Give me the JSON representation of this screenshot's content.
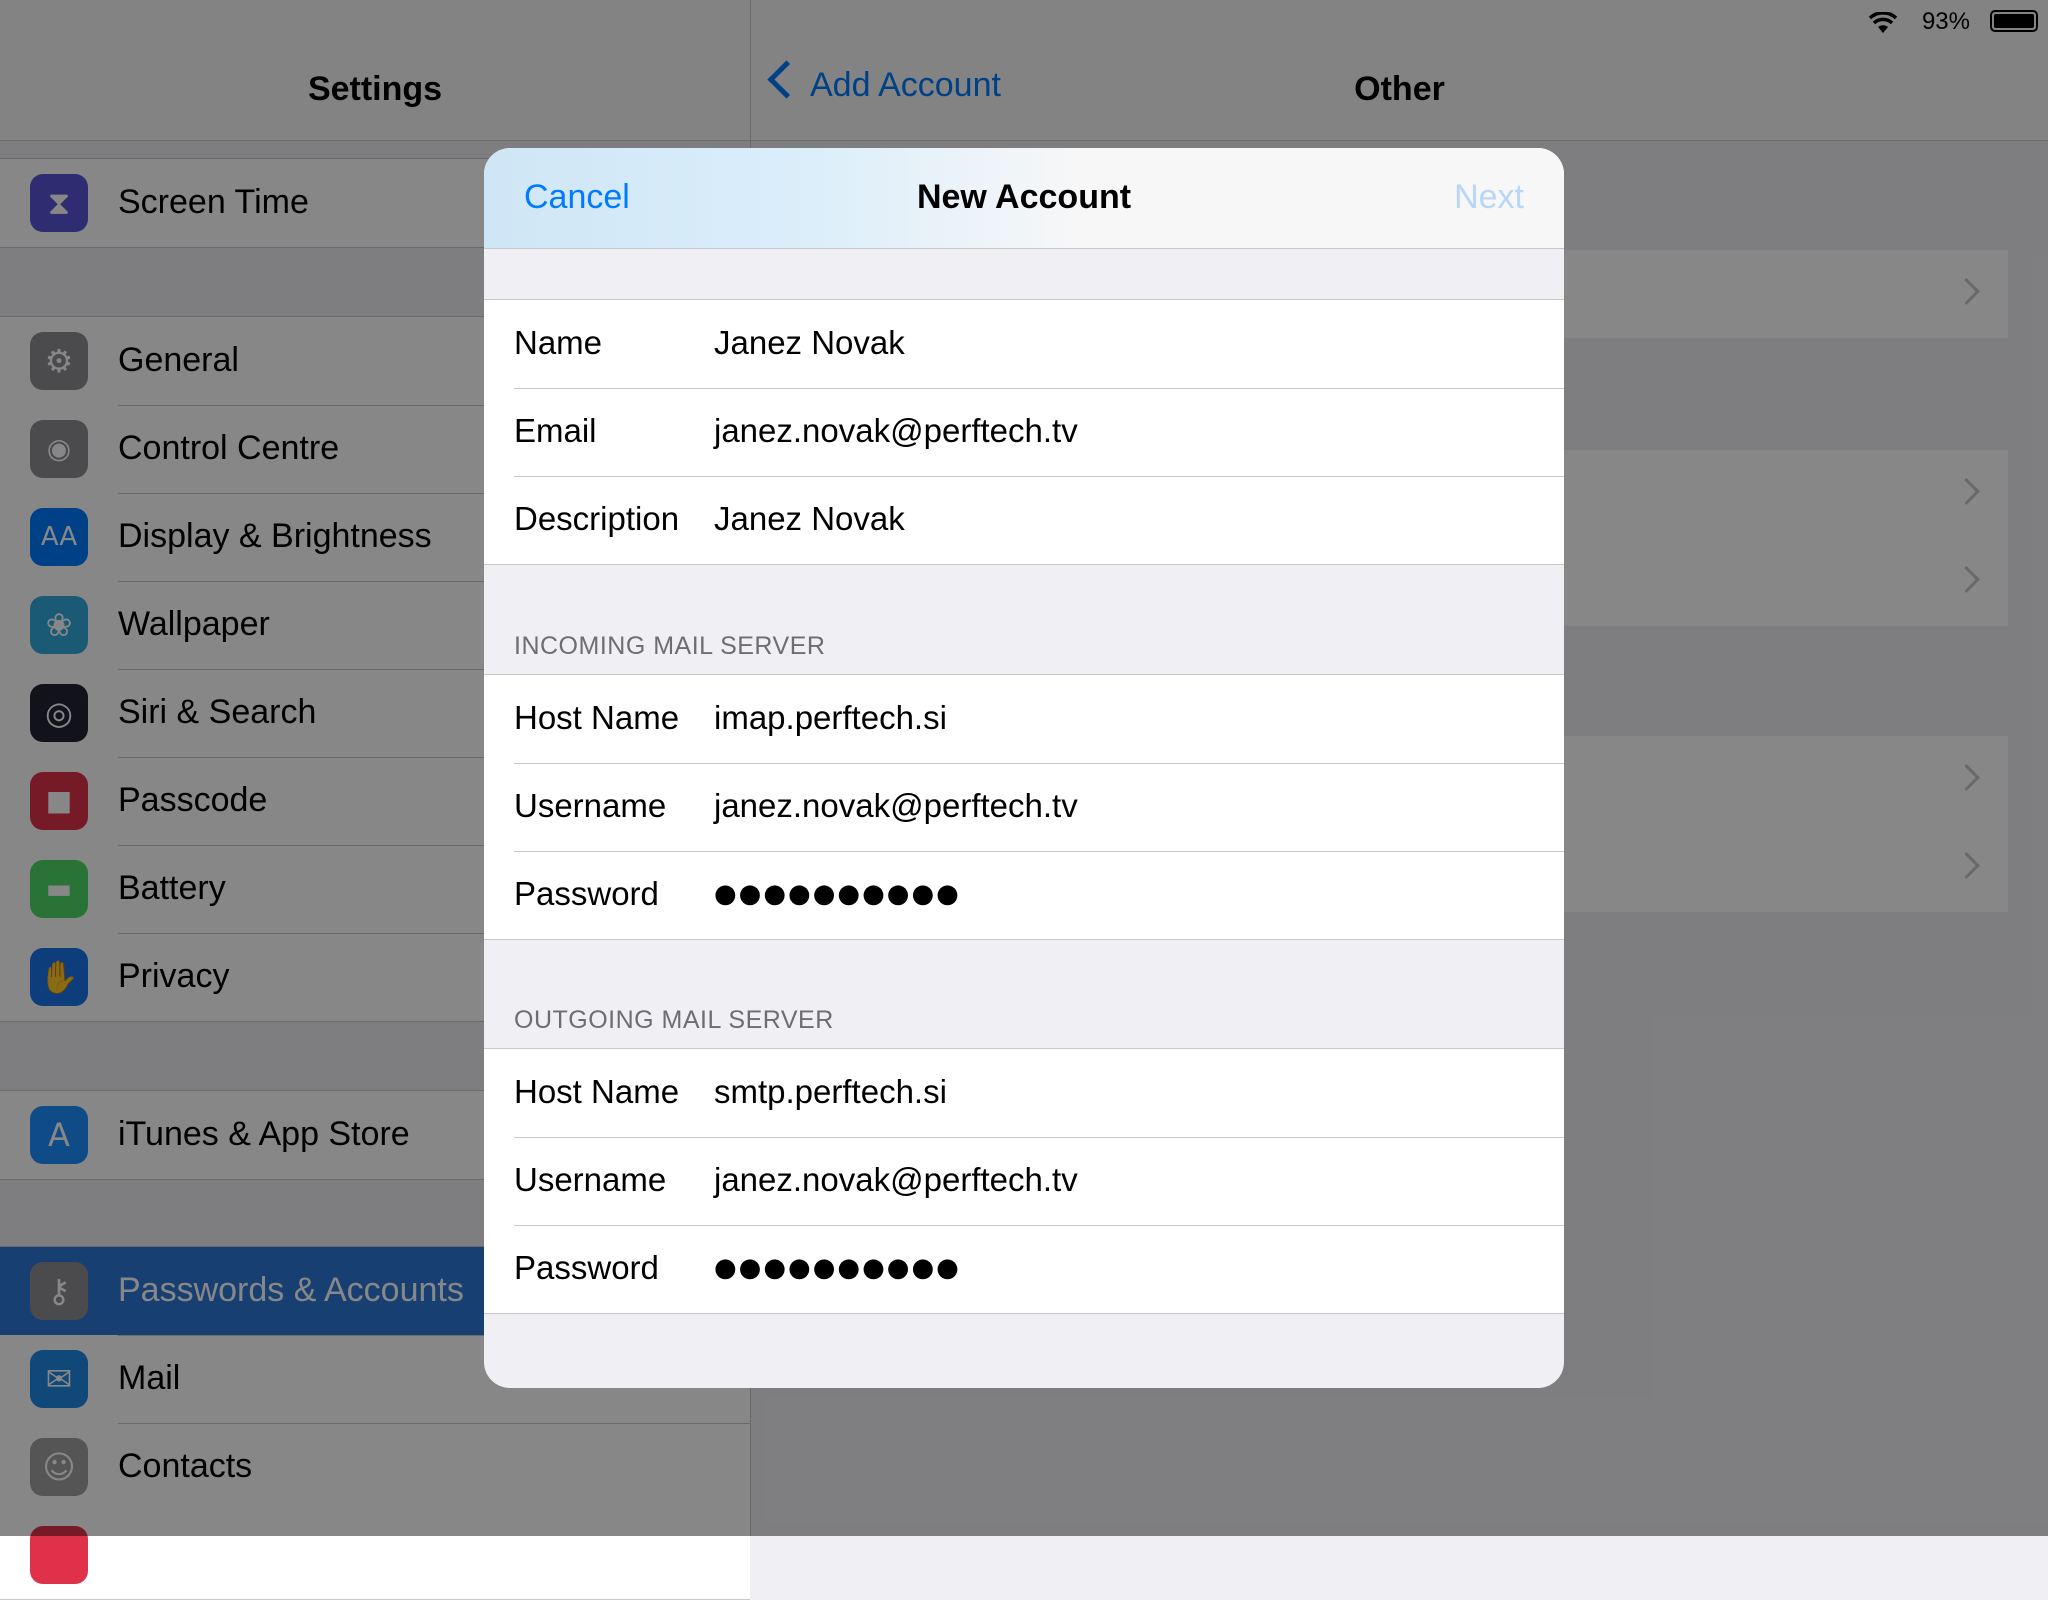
{
  "status_bar": {
    "battery_percent": "93%",
    "wifi_icon": "wifi-icon",
    "battery_icon": "battery-icon"
  },
  "sidebar": {
    "title": "Settings",
    "groups": [
      [
        {
          "label": "Screen Time",
          "icon": "hourglass-icon",
          "color": "#5856d6"
        }
      ],
      [
        {
          "label": "General",
          "icon": "gear-icon",
          "color": "#8e8e93"
        },
        {
          "label": "Control Centre",
          "icon": "toggles-icon",
          "color": "#8e8e93"
        },
        {
          "label": "Display & Brightness",
          "icon": "text-size-icon",
          "color": "#007aff"
        },
        {
          "label": "Wallpaper",
          "icon": "flower-icon",
          "color": "#34aadc"
        },
        {
          "label": "Siri & Search",
          "icon": "siri-icon",
          "color": "#222233"
        },
        {
          "label": "Passcode",
          "icon": "lock-icon",
          "color": "#e0314b"
        },
        {
          "label": "Battery",
          "icon": "battery-icon",
          "color": "#4cd964"
        },
        {
          "label": "Privacy",
          "icon": "hand-icon",
          "color": "#1a73e8"
        }
      ],
      [
        {
          "label": "iTunes & App Store",
          "icon": "app-store-icon",
          "color": "#1e90ff"
        }
      ],
      [
        {
          "label": "Passwords & Accounts",
          "icon": "key-icon",
          "color": "#8e8e93",
          "selected": true
        },
        {
          "label": "Mail",
          "icon": "envelope-icon",
          "color": "#1e88e5"
        },
        {
          "label": "Contacts",
          "icon": "contacts-icon",
          "color": "#a0a0a0"
        }
      ]
    ]
  },
  "detail": {
    "back_label": "Add Account",
    "title": "Other"
  },
  "modal": {
    "cancel_label": "Cancel",
    "title": "New Account",
    "next_label": "Next",
    "account": [
      {
        "label": "Name",
        "value": "Janez Novak"
      },
      {
        "label": "Email",
        "value": "janez.novak@perftech.tv"
      },
      {
        "label": "Description",
        "value": "Janez Novak"
      }
    ],
    "incoming": {
      "header": "INCOMING MAIL SERVER",
      "rows": [
        {
          "label": "Host Name",
          "value": "imap.perftech.si"
        },
        {
          "label": "Username",
          "value": "janez.novak@perftech.tv"
        },
        {
          "label": "Password",
          "value": "●●●●●●●●●●"
        }
      ]
    },
    "outgoing": {
      "header": "OUTGOING MAIL SERVER",
      "rows": [
        {
          "label": "Host Name",
          "value": "smtp.perftech.si"
        },
        {
          "label": "Username",
          "value": "janez.novak@perftech.tv"
        },
        {
          "label": "Password",
          "value": "●●●●●●●●●●"
        }
      ]
    }
  }
}
